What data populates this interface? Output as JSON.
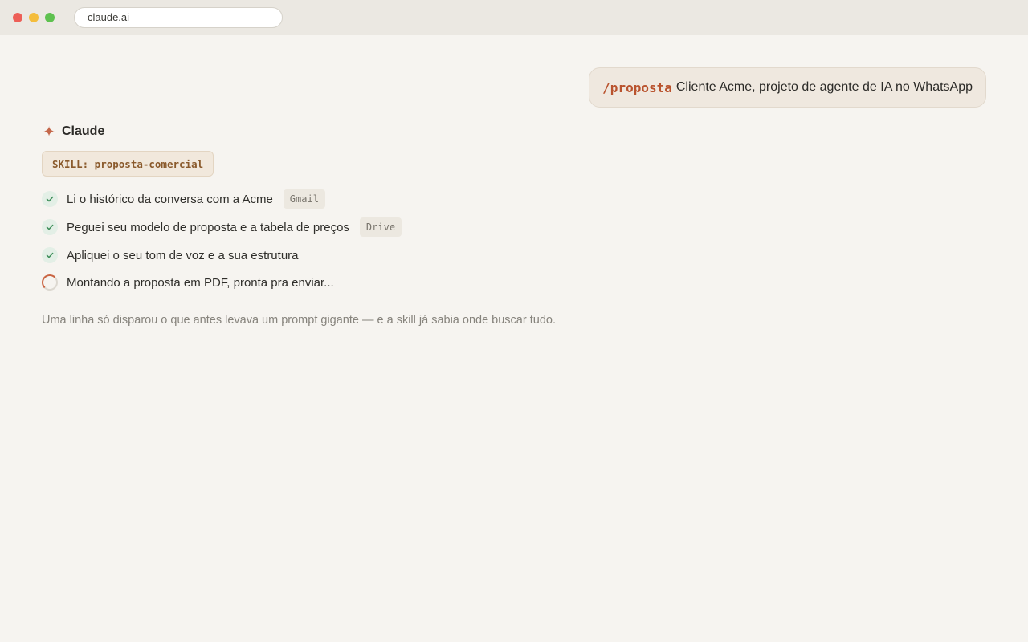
{
  "browser": {
    "url": "claude.ai"
  },
  "user_message": {
    "command": "/proposta",
    "text": "Cliente Acme, projeto de agente de IA no WhatsApp"
  },
  "assistant": {
    "icon": "sparkle-icon",
    "name": "Claude",
    "skill_label": "SKILL: proposta-comercial",
    "steps": [
      {
        "status": "done",
        "text": "Li o histórico da conversa com a Acme",
        "tag": "Gmail"
      },
      {
        "status": "done",
        "text": "Peguei seu modelo de proposta e a tabela de preços",
        "tag": "Drive"
      },
      {
        "status": "done",
        "text": "Apliquei o seu tom de voz e a sua estrutura",
        "tag": ""
      },
      {
        "status": "in_progress",
        "text": "Montando a proposta em PDF, pronta pra enviar...",
        "tag": ""
      }
    ],
    "footnote": "Uma linha só disparou o que antes levava um prompt gigante — e a skill já sabia onde buscar tudo."
  },
  "colors": {
    "accent": "#c96442",
    "check": "#3f8f5a",
    "background": "#f6f4f0"
  }
}
